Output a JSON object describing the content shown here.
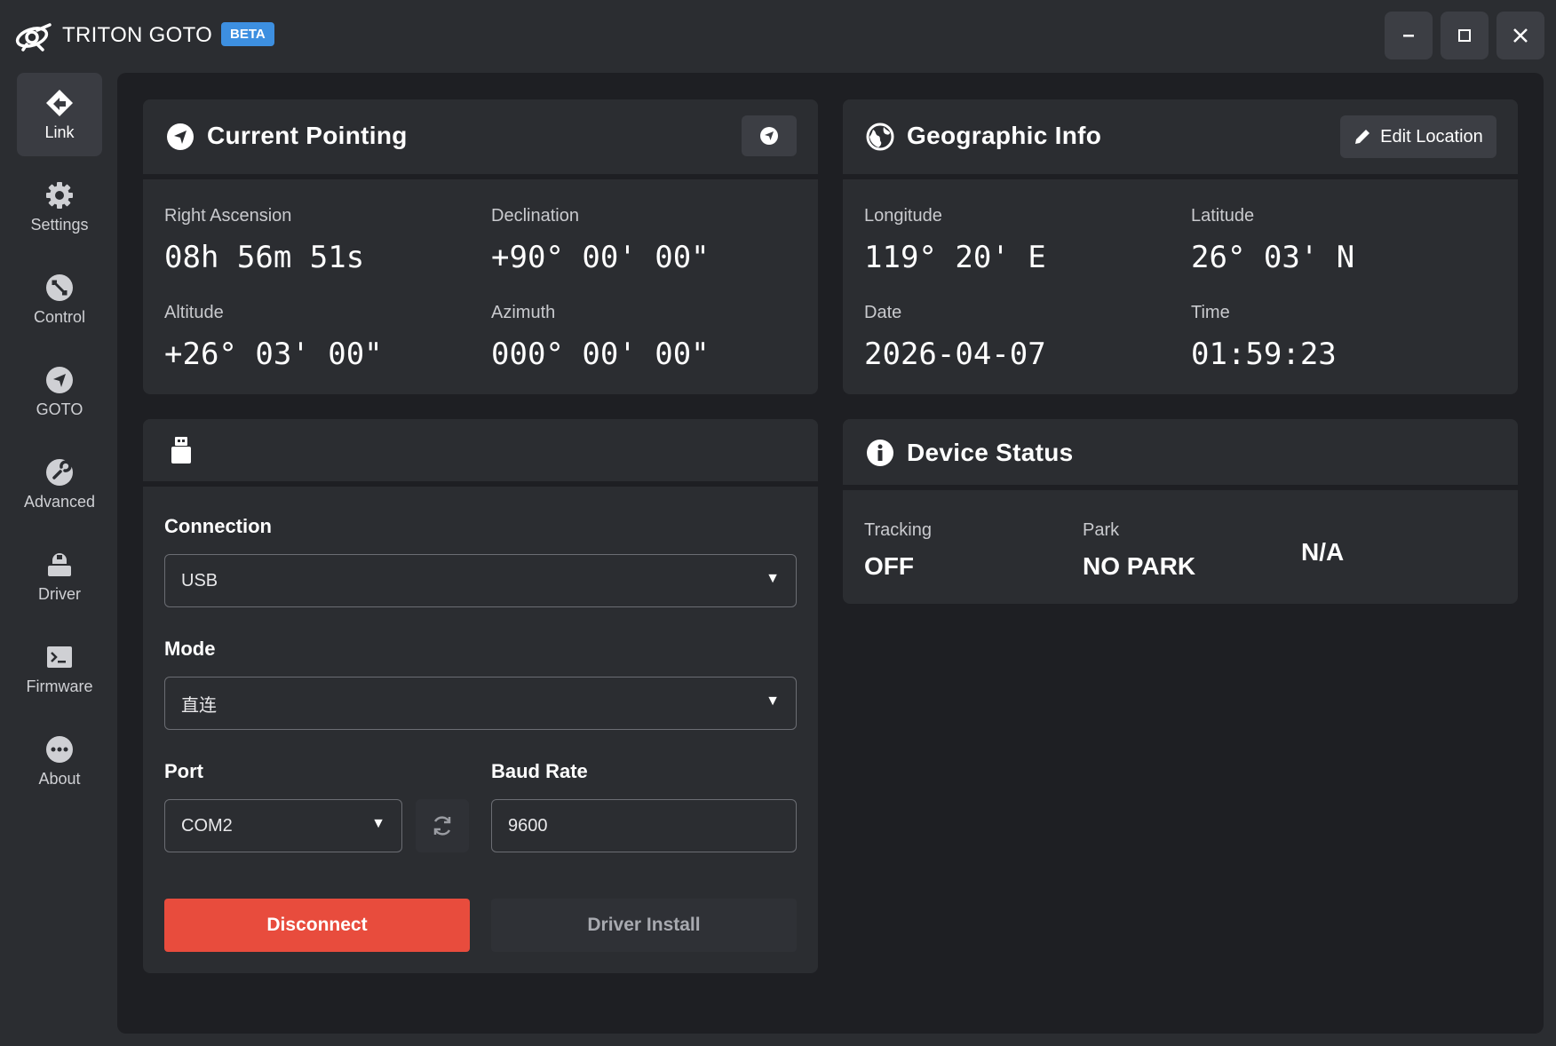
{
  "app": {
    "title": "TRITON GOTO",
    "badge": "BETA"
  },
  "window_controls": {
    "minimize": "−",
    "maximize": "☐",
    "close": "✕"
  },
  "sidebar": {
    "items": [
      {
        "label": "Link",
        "icon": "link-icon",
        "active": true
      },
      {
        "label": "Settings",
        "icon": "gear-icon"
      },
      {
        "label": "Control",
        "icon": "control-icon"
      },
      {
        "label": "GOTO",
        "icon": "navigation-icon"
      },
      {
        "label": "Advanced",
        "icon": "wrench-icon"
      },
      {
        "label": "Driver",
        "icon": "usb-drive-icon"
      },
      {
        "label": "Firmware",
        "icon": "terminal-icon"
      },
      {
        "label": "About",
        "icon": "more-icon"
      }
    ]
  },
  "pointing": {
    "title": "Current Pointing",
    "ra_label": "Right Ascension",
    "ra_value": "08h 56m 51s",
    "dec_label": "Declination",
    "dec_value": "+90° 00' 00\"",
    "alt_label": "Altitude",
    "alt_value": "+26° 03' 00\"",
    "az_label": "Azimuth",
    "az_value": "000° 00' 00\""
  },
  "geo": {
    "title": "Geographic Info",
    "edit_label": "Edit Location",
    "lon_label": "Longitude",
    "lon_value": "119° 20' E",
    "lat_label": "Latitude",
    "lat_value": "26° 03' N",
    "date_label": "Date",
    "date_value": "2026-04-07",
    "time_label": "Time",
    "time_value": "01:59:23"
  },
  "connection": {
    "connection_label": "Connection",
    "connection_value": "USB",
    "mode_label": "Mode",
    "mode_value": "直连",
    "port_label": "Port",
    "port_value": "COM2",
    "baud_label": "Baud Rate",
    "baud_value": "9600",
    "disconnect_label": "Disconnect",
    "driver_install_label": "Driver Install"
  },
  "device_status": {
    "title": "Device Status",
    "tracking_label": "Tracking",
    "tracking_value": "OFF",
    "park_label": "Park",
    "park_value": "NO PARK",
    "extra_value": "N/A"
  },
  "colors": {
    "accent": "#3d8fe0",
    "danger": "#e84c3d",
    "background": "#1e1f23",
    "card": "#2b2d31"
  }
}
